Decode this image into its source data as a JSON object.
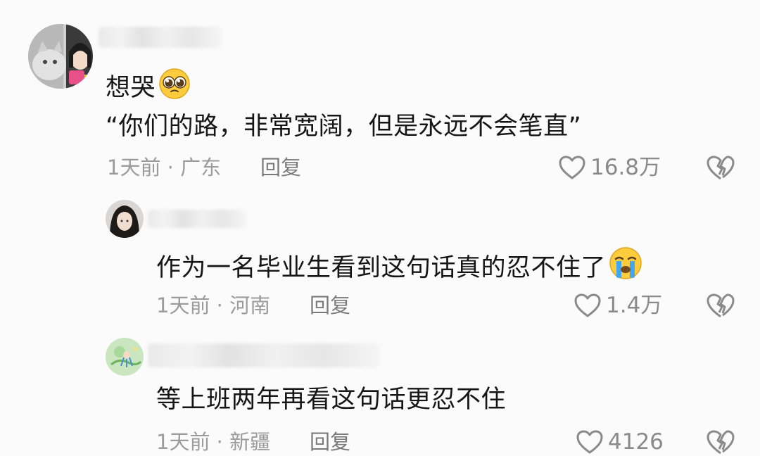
{
  "comments": [
    {
      "lines": [
        "想哭",
        "“你们的路，非常宽阔，但是永远不会笔直”"
      ],
      "emoji": "pleading-face",
      "meta": "1天前 · 广东",
      "reply_label": "回复",
      "likes": "16.8万"
    },
    {
      "text": "作为一名毕业生看到这句话真的忍不住了",
      "emoji": "crying-face",
      "meta": "1天前 · 河南",
      "reply_label": "回复",
      "likes": "1.4万"
    },
    {
      "text": "等上班两年再看这句话更忍不住",
      "meta": "1天前 · 新疆",
      "reply_label": "回复",
      "likes": "4126"
    }
  ],
  "icons": {
    "like": "heart-outline-icon",
    "dislike": "broken-heart-outline-icon"
  },
  "colors": {
    "background": "#fbfbfb",
    "text": "#161616",
    "meta": "#9b9b9b",
    "icon": "#8a8a8a"
  }
}
